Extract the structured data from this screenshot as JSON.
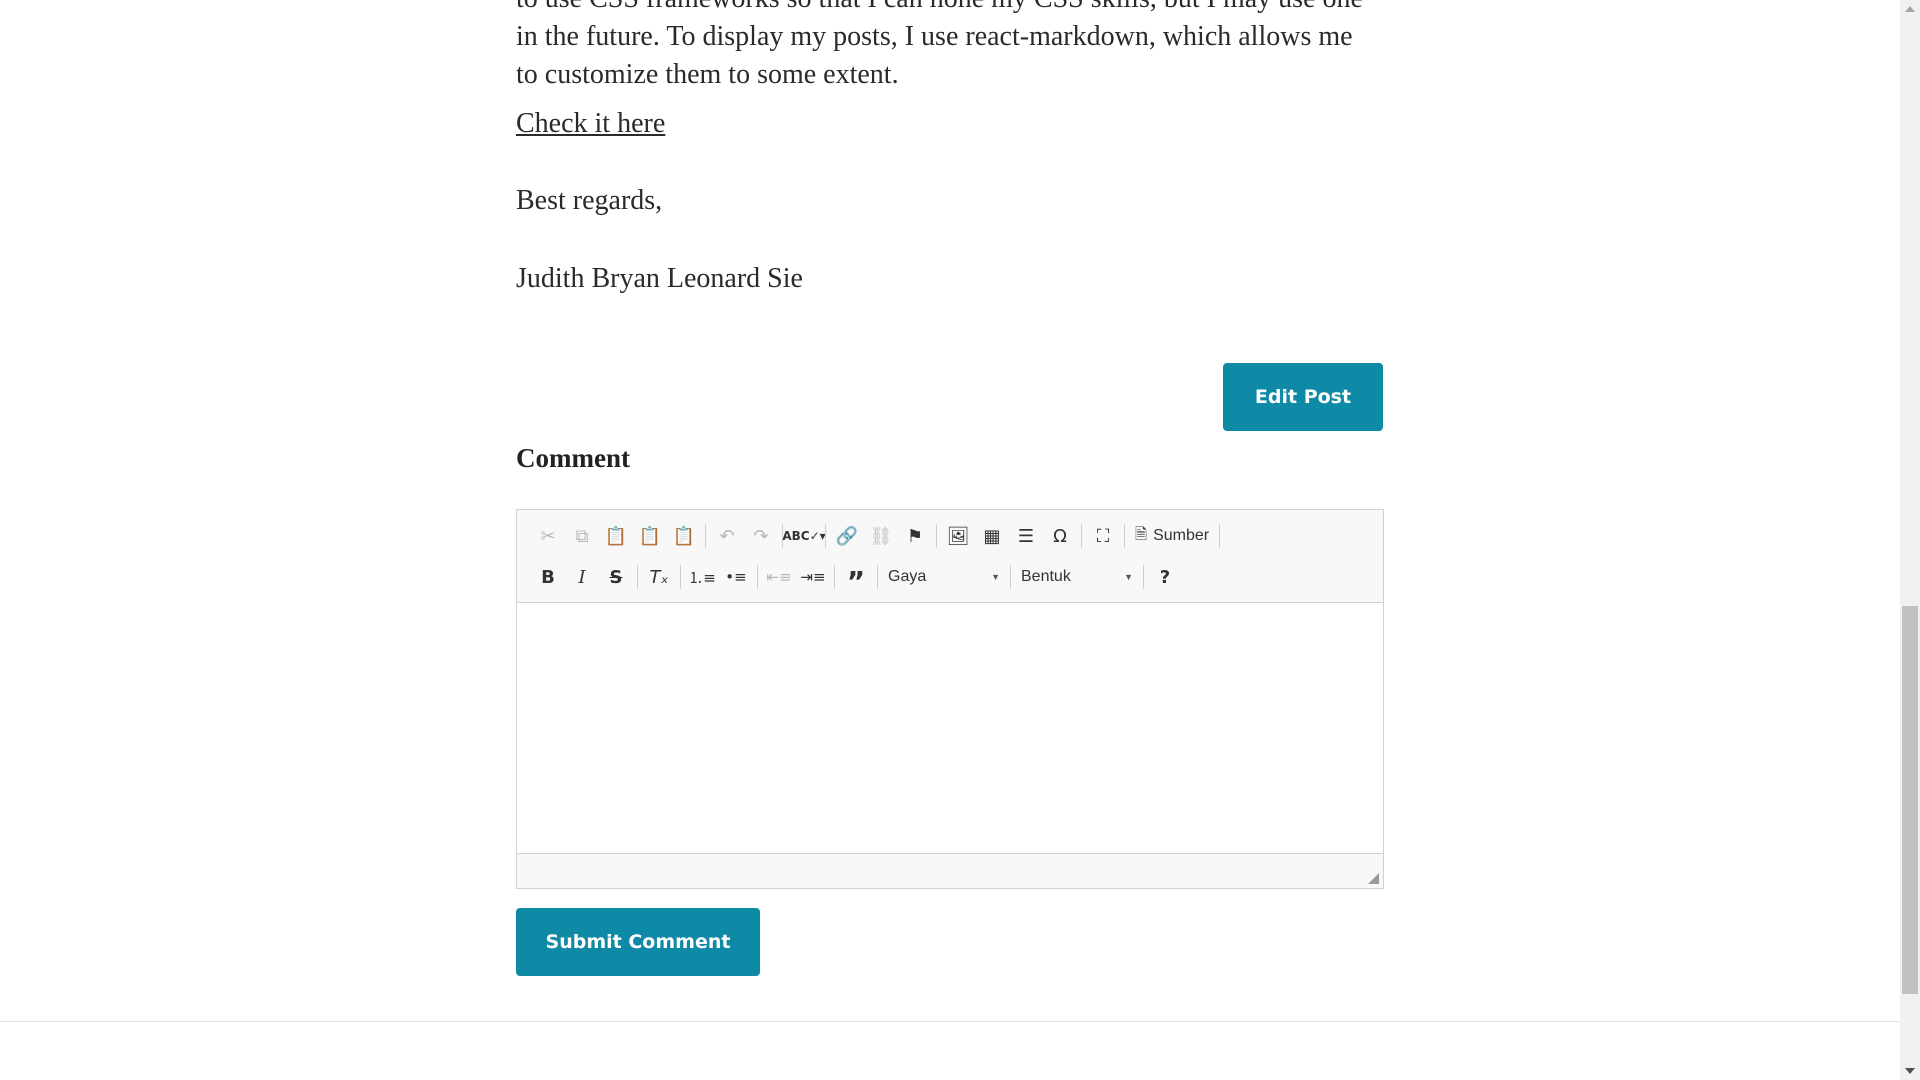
{
  "post": {
    "paragraph_lines": [
      "to use CSS frameworks so that I can hone my CSS skills, but I may use one",
      "in the future. To display my posts, I use react-markdown, which allows me",
      "to customize them to some extent."
    ],
    "link_text": "Check it here",
    "regards": "Best regards,",
    "signature": "Judith Bryan Leonard Sie",
    "edit_label": "Edit Post"
  },
  "comment": {
    "title": "Comment",
    "submit_label": "Submit Comment",
    "toolbar": {
      "row1_icons": [
        "cut-icon",
        "copy-icon",
        "paste-icon",
        "paste-text-icon",
        "paste-word-icon",
        "undo-icon",
        "redo-icon",
        "spellcheck-icon",
        "link-icon",
        "unlink-icon",
        "anchor-icon",
        "image-icon",
        "table-icon",
        "horizontal-line-icon",
        "special-char-icon",
        "maximize-icon",
        "source-icon"
      ],
      "source_label": "Sumber",
      "row2_icons": [
        "bold-icon",
        "italic-icon",
        "strike-icon",
        "remove-format-icon",
        "numbered-list-icon",
        "bulleted-list-icon",
        "outdent-icon",
        "indent-icon",
        "blockquote-icon",
        "help-icon"
      ],
      "style_combo": "Gaya",
      "format_combo": "Bentuk"
    }
  },
  "colors": {
    "accent": "#0e8aa6",
    "text": "#2a2a2a",
    "toolbar_bg": "#f8f8f8"
  }
}
